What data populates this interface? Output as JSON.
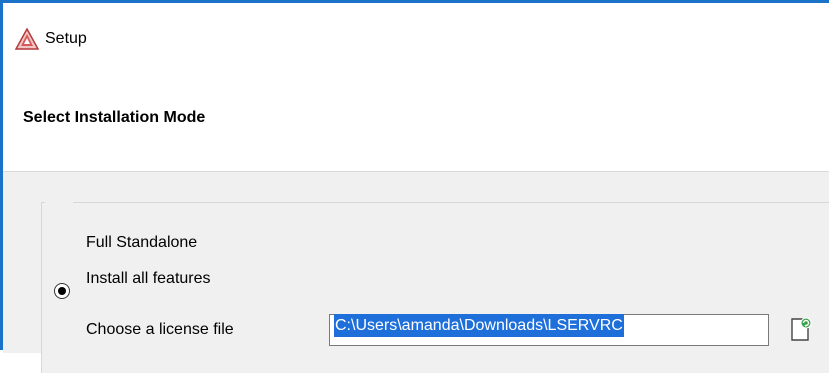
{
  "window": {
    "title": "Setup",
    "accent_color": "#1a73c8",
    "icon": "warning-triangle-app-icon"
  },
  "header": {
    "title": "Select Installation Mode"
  },
  "mode_option": {
    "title": "Full Standalone",
    "description": "Install all features",
    "selected": true
  },
  "license": {
    "label": "Choose a license file",
    "value": "C:\\Users\\amanda\\Downloads\\LSERVRC",
    "browse_icon": "browse-file-icon"
  }
}
